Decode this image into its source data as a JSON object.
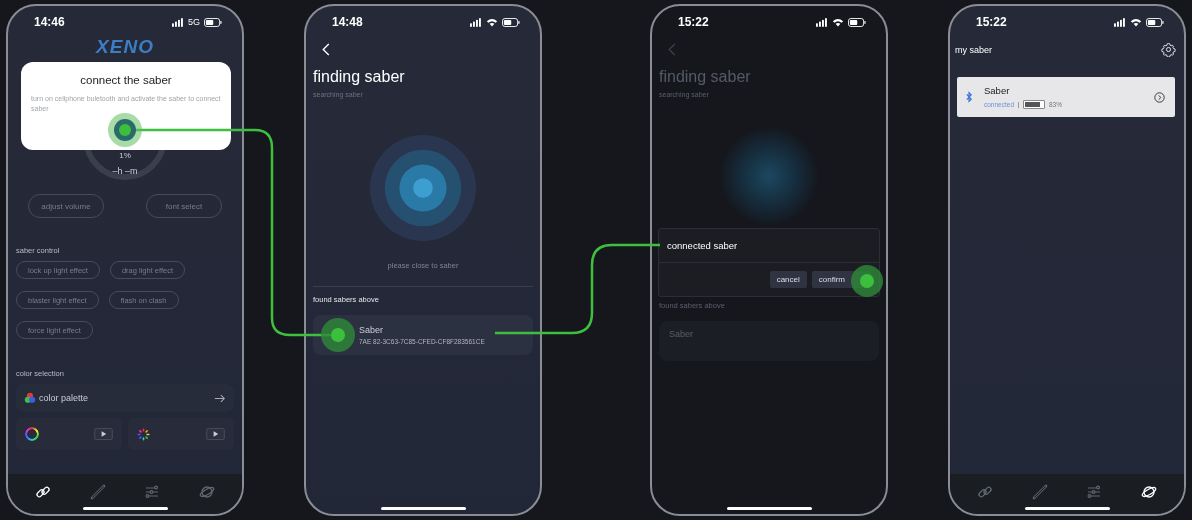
{
  "phones": [
    {
      "kind": "home",
      "time": "14:46",
      "network": "5G",
      "logo": "XENO",
      "popup": {
        "title": "connect the saber",
        "message": "turn on cellphone buletooth and activate the saber to connect saber"
      },
      "gauge": {
        "value": "1%",
        "remaining": "–h –m"
      },
      "actions": [
        "adjust volume",
        "font select"
      ],
      "saber_control": {
        "title": "saber control",
        "effects": [
          "lock up light effect",
          "drag light effect",
          "blaster light effect",
          "flash on clash",
          "force light effect"
        ]
      },
      "color_selection": {
        "title": "color selection",
        "palette": "color palette"
      },
      "tabs": [
        {
          "kind": "link",
          "selected": true
        },
        {
          "kind": "saber",
          "selected": false
        },
        {
          "kind": "sliders",
          "selected": false
        },
        {
          "kind": "planet",
          "selected": false
        }
      ]
    },
    {
      "kind": "search",
      "time": "14:48",
      "title": "finding saber",
      "subtitle": "searching saber",
      "hint": "please close to saber",
      "found_title": "found sabers above",
      "devices": [
        {
          "name": "Saber",
          "id": "7AE 82-3C63-7C85-CFED-CF8F283561CE"
        }
      ]
    },
    {
      "kind": "dialog",
      "time": "15:22",
      "background": {
        "title": "finding saber",
        "subtitle": "searching saber",
        "found_title": "found sabers above",
        "device": "Saber"
      },
      "dialog": {
        "message": "connected saber",
        "buttons": [
          "cancel",
          "confirm"
        ]
      }
    },
    {
      "kind": "list",
      "time": "15:22",
      "title": "my saber",
      "sabers": [
        {
          "name": "Saber",
          "status": "connected",
          "battery": "83%",
          "level": 0.83
        }
      ],
      "tabs": [
        {
          "kind": "link",
          "selected": false
        },
        {
          "kind": "saber",
          "selected": false
        },
        {
          "kind": "sliders",
          "selected": false
        },
        {
          "kind": "planet",
          "selected": true
        }
      ]
    }
  ]
}
